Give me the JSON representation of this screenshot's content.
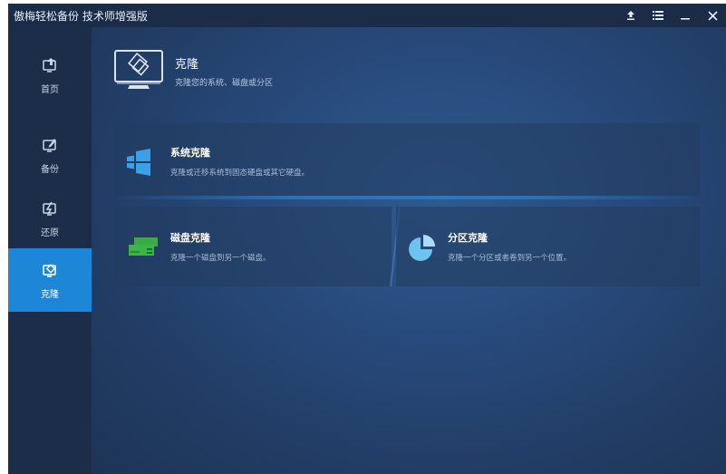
{
  "window": {
    "title": "傲梅轻松备份 技术师增强版"
  },
  "title_controls": [
    {
      "name": "upgrade-icon",
      "glyph": "≙"
    },
    {
      "name": "menu-icon",
      "glyph": "≡"
    },
    {
      "name": "minimize-icon",
      "glyph": "—"
    },
    {
      "name": "close-icon",
      "glyph": "✕"
    }
  ],
  "sidebar": {
    "items": [
      {
        "label": "首页",
        "icon": "home-icon",
        "active": false
      },
      {
        "label": "备份",
        "icon": "backup-icon",
        "active": false
      },
      {
        "label": "还原",
        "icon": "restore-icon",
        "active": false
      },
      {
        "label": "克隆",
        "icon": "clone-icon",
        "active": true
      }
    ]
  },
  "header": {
    "title": "克隆",
    "subtitle": "克隆您的系统、磁盘或分区",
    "icon": "clone-monitor-icon"
  },
  "cards": {
    "system_clone": {
      "title": "系统克隆",
      "desc": "克隆或迁移系统到固态硬盘或其它硬盘。",
      "icon": "windows-icon"
    },
    "disk_clone": {
      "title": "磁盘克隆",
      "desc": "克隆一个磁盘到另一个磁盘。",
      "icon": "disk-icon"
    },
    "partition_clone": {
      "title": "分区克隆",
      "desc": "克隆一个分区或者卷到另一个位置。",
      "icon": "partition-icon"
    }
  },
  "colors": {
    "accent": "#1e86d6",
    "titlebar": "#1a2c48",
    "sidebar": "#1b2d49",
    "windows_icon": "#3aa0e8",
    "disk_icon": "#39b54a",
    "partition_icon": "#6cc3f0"
  }
}
